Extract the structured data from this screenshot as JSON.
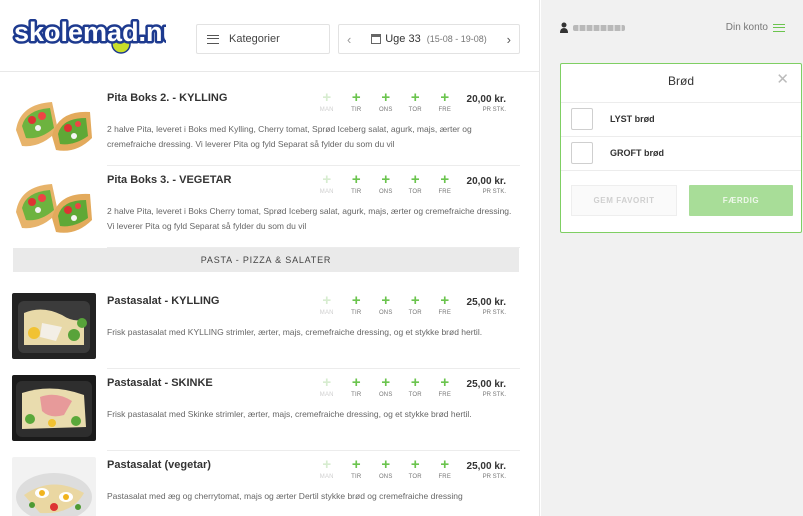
{
  "brand": {
    "logo_text": "skolemad.nu"
  },
  "header": {
    "categories_label": "Kategorier",
    "week_label": "Uge 33",
    "week_range": "(15-08 - 19-08)"
  },
  "days": [
    "MAN",
    "TIR",
    "ONS",
    "TOR",
    "FRE"
  ],
  "price_unit": "PR STK.",
  "products": [
    {
      "name": "Pita Boks 2. - KYLLING",
      "price": "20,00 kr.",
      "desc": "2 halve Pita, leveret i Boks med Kylling, Cherry tomat, Sprød Iceberg salat, agurk, majs, ærter og cremefraiche dressing. Vi leverer Pita og fyld Separat så fylder du som du vil",
      "thumb": "pita"
    },
    {
      "name": "Pita Boks 3. - VEGETAR",
      "price": "20,00 kr.",
      "desc": "2 halve Pita, leveret i Boks Cherry tomat, Sprød Iceberg salat, agurk, majs, ærter og cremefraiche dressing. Vi leverer Pita og fyld Separat så fylder du som du vil",
      "thumb": "pita"
    },
    {
      "name": "Pastasalat - KYLLING",
      "price": "25,00 kr.",
      "desc": "Frisk pastasalat med KYLLING strimler, ærter, majs, cremefraiche dressing, og et stykke brød hertil.",
      "thumb": "pasta-chicken"
    },
    {
      "name": "Pastasalat - SKINKE",
      "price": "25,00 kr.",
      "desc": "Frisk pastasalat med Skinke strimler, ærter, majs, cremefraiche dressing, og et stykke brød hertil.",
      "thumb": "pasta-ham"
    },
    {
      "name": "Pastasalat (vegetar)",
      "price": "25,00 kr.",
      "desc": "Pastasalat med æg og cherrytomat, majs og ærter Dertil stykke brød og cremefraiche dressing",
      "thumb": "pasta-veg"
    }
  ],
  "section_title": "PASTA - PIZZA & SALATER",
  "account": {
    "label": "Din konto"
  },
  "panel": {
    "title": "Brød",
    "options": [
      "LYST brød",
      "GROFT brød"
    ],
    "fav_label": "GEM FAVORIT",
    "done_label": "FÆRDIG"
  },
  "colors": {
    "accent": "#6bc44e",
    "accent_light": "#a8dd98",
    "logo_blue": "#1d3a8f",
    "logo_yellow": "#c9df2a"
  },
  "icons": [
    "hamburger-menu-icon",
    "chevron-left-icon",
    "calendar-icon",
    "chevron-right-icon",
    "plus-icon",
    "user-icon",
    "close-icon"
  ]
}
